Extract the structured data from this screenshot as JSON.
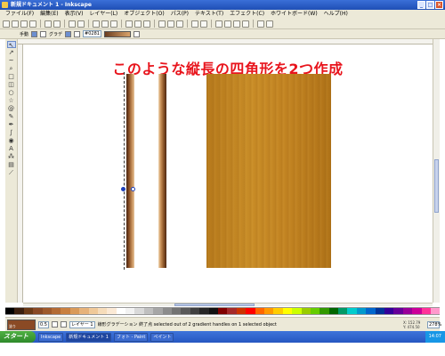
{
  "window": {
    "title": "新規ドキュメント 1 - Inkscape",
    "buttons": [
      "_",
      "□",
      "×"
    ]
  },
  "menubar": {
    "items": [
      "ファイル(F)",
      "編集(E)",
      "表示(V)",
      "レイヤー(L)",
      "オブジェクト(O)",
      "パス(P)",
      "テキスト(T)",
      "エフェクト(C)",
      "ホワイトボード(W)",
      "ヘルプ(H)"
    ]
  },
  "ctxbar": {
    "label_prefix": "手動",
    "label_gradient": "グラデ",
    "field_value": "#0281"
  },
  "canvas": {
    "annotation": "このような縦長の四角形を2つ作成"
  },
  "palette": {
    "colors": [
      "#000000",
      "#3b1f0e",
      "#6b3a16",
      "#8a4a25",
      "#9e5a2c",
      "#b36b35",
      "#c98040",
      "#d99a5a",
      "#e6b27a",
      "#f0c999",
      "#f6dcba",
      "#fbe9d5",
      "#ffffff",
      "#f2f2f2",
      "#d9d9d9",
      "#bfbfbf",
      "#a6a6a6",
      "#8c8c8c",
      "#737373",
      "#595959",
      "#404040",
      "#262626",
      "#111111",
      "#800000",
      "#a52a2a",
      "#cc3300",
      "#ff0000",
      "#ff6600",
      "#ff9900",
      "#ffcc00",
      "#ffff00",
      "#ccff00",
      "#99cc00",
      "#66cc00",
      "#339900",
      "#006600",
      "#009966",
      "#00cccc",
      "#0099cc",
      "#0066cc",
      "#003399",
      "#330099",
      "#660099",
      "#990099",
      "#cc0099",
      "#ff3399",
      "#ff99cc"
    ]
  },
  "statusbar": {
    "fill_label": "塗り",
    "stroke_label": "ストローク",
    "opacity_value": "0.5",
    "layer": "レイヤー 1",
    "message": "線形グラデーション 終了点 selected out of 2 gradient handles on 1 selected object",
    "coords_x": "X: 152.79",
    "coords_y": "Y: 474.50",
    "zoom": "278%"
  },
  "taskbar": {
    "start": "スタート",
    "tasks": [
      "Inkscape",
      "新規ドキュメント 1",
      "フォト - Paint",
      "ペイント"
    ],
    "clock": "14:07"
  }
}
